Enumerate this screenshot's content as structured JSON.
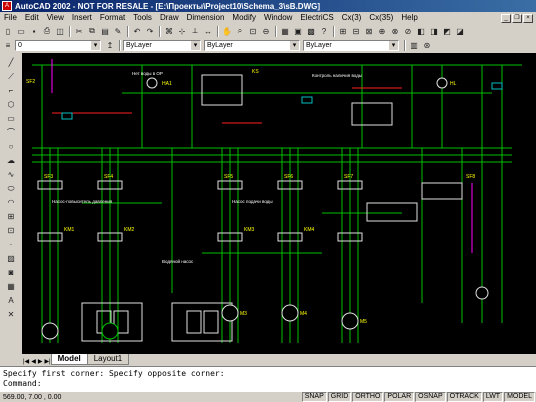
{
  "titlebar": {
    "title": "AutoCAD 2002 - NOT FOR RESALE - [E:\\Проекты\\Project10\\Schema_3\\sB.DWG]"
  },
  "menu": [
    "File",
    "Edit",
    "View",
    "Insert",
    "Format",
    "Tools",
    "Draw",
    "Dimension",
    "Modify",
    "Window",
    "ElectriCS",
    "Cx(3)",
    "Cx(35)",
    "Help"
  ],
  "toolbar2": {
    "layer_value": "0",
    "color_value": "ByLayer",
    "linetype_value": "ByLayer",
    "lineweight_value": "ByLayer"
  },
  "canvas_labels": {
    "sf2": "SF2",
    "sf3": "SF3",
    "sf4": "SF4",
    "sf5": "SF5",
    "sf6": "SF6",
    "sf7": "SF7",
    "sf8": "SF8",
    "km1": "KM1",
    "km2": "KM2",
    "km3": "KM3",
    "km4": "KM4",
    "ks": "KS",
    "ha1": "HA1",
    "hl": "HL",
    "m3": "M3",
    "m4": "M4",
    "m5": "M5",
    "lbl_top1": "Нет воды в ОР",
    "lbl_top2": "Контроль наличия воды",
    "lbl_mid1": "Насос-повыситель давления",
    "lbl_mid2": "Насос подачи воды",
    "lbl_mid3": "Водяной насос"
  },
  "tabs": {
    "model": "Model",
    "layout1": "Layout1"
  },
  "command": {
    "line1": "Specify first corner: Specify opposite corner:",
    "line2": "Command:"
  },
  "status": {
    "coords": "569.00, 7.00 , 0.00",
    "snap": "SNAP",
    "grid": "GRID",
    "ortho": "ORTHO",
    "polar": "POLAR",
    "osnap": "OSNAP",
    "otrack": "OTRACK",
    "lwt": "LWT",
    "model": "MODEL"
  }
}
